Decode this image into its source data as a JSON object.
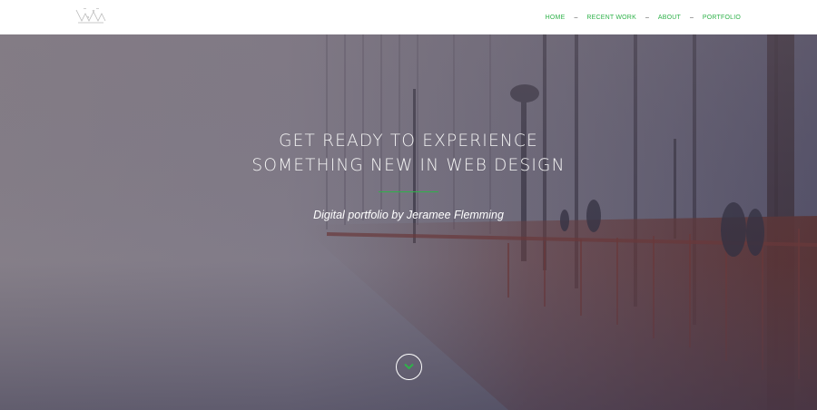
{
  "nav": {
    "items": [
      "HOME",
      "RECENT WORK",
      "ABOUT",
      "PORTFOLIO"
    ],
    "separator": "–"
  },
  "hero": {
    "title_line1": "GET READY TO EXPERIENCE",
    "title_line2": "SOMETHING NEW IN WEB DESIGN",
    "subtitle": "Digital portfolio by Jeramee Flemming",
    "scroll_icon": "chevron-down-icon"
  },
  "colors": {
    "accent": "#2fb24a",
    "hero_overlay": "#5a5668",
    "bridge": "#6b3b35"
  }
}
